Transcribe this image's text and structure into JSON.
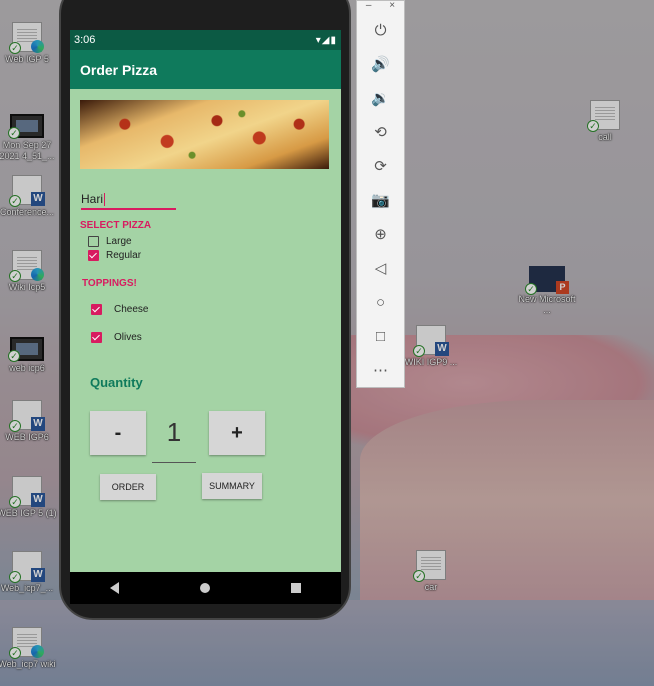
{
  "desktop_icons": [
    {
      "label": "Web IGP 5",
      "kind": "edge"
    },
    {
      "label": "Mon Sep 27 2021 4_51_...",
      "kind": "video"
    },
    {
      "label": "Conference...",
      "kind": "word"
    },
    {
      "label": "Wiki Icp5",
      "kind": "edge"
    },
    {
      "label": "web icp6",
      "kind": "video"
    },
    {
      "label": "WEB IGP6",
      "kind": "word"
    },
    {
      "label": "WEB IGP 5 (1)",
      "kind": "word"
    },
    {
      "label": "Web_icp7_...",
      "kind": "word"
    },
    {
      "label": "Web_icp7 wiki",
      "kind": "edge"
    },
    {
      "label": "call",
      "kind": "doc"
    },
    {
      "label": "New Microsoft ...",
      "kind": "ppt"
    },
    {
      "label": "WIKI IGP9 ...",
      "kind": "word"
    },
    {
      "label": "car",
      "kind": "doc"
    }
  ],
  "emulator": {
    "minimize": "–",
    "close": "×",
    "buttons": [
      "power-icon",
      "volume-up-icon",
      "volume-down-icon",
      "rotate-left-icon",
      "rotate-right-icon",
      "camera-icon",
      "zoom-icon",
      "back-icon",
      "home-icon",
      "overview-icon",
      "more-icon"
    ]
  },
  "status_bar": {
    "time": "3:06",
    "right": "▾◢▮"
  },
  "app": {
    "title": "Order Pizza",
    "name_value": "Hari",
    "select_pizza_label": "SELECT PIZZA",
    "pizza_options": [
      {
        "label": "Large",
        "checked": false
      },
      {
        "label": "Regular",
        "checked": true
      }
    ],
    "toppings_label": "TOPPINGS!",
    "toppings": [
      {
        "label": "Cheese",
        "checked": true
      },
      {
        "label": "Olives",
        "checked": true
      }
    ],
    "quantity_label": "Quantity",
    "minus_label": "-",
    "quantity_value": "1",
    "plus_label": "+",
    "order_label": "ORDER",
    "summary_label": "SUMMARY"
  }
}
